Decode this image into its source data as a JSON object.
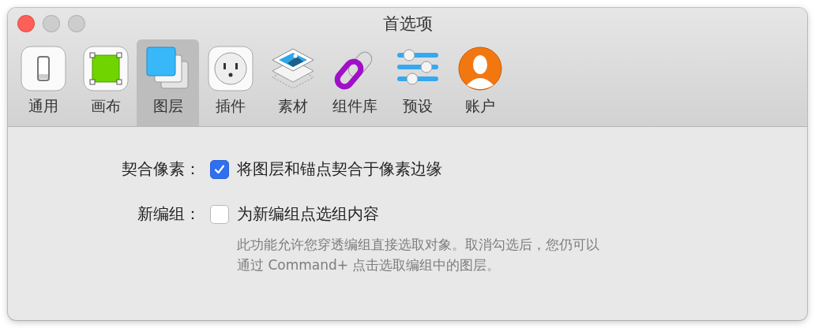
{
  "window": {
    "title": "首选项"
  },
  "tabs": [
    {
      "label": "通用",
      "kind": "switch",
      "selected": false
    },
    {
      "label": "画布",
      "kind": "canvas",
      "selected": false
    },
    {
      "label": "图层",
      "kind": "layers",
      "selected": true
    },
    {
      "label": "插件",
      "kind": "plugin",
      "selected": false
    },
    {
      "label": "素材",
      "kind": "assets",
      "selected": false
    },
    {
      "label": "组件库",
      "kind": "library",
      "selected": false
    },
    {
      "label": "预设",
      "kind": "presets",
      "selected": false
    },
    {
      "label": "账户",
      "kind": "account",
      "selected": false
    }
  ],
  "options": [
    {
      "label": "契合像素：",
      "text": "将图层和锚点契合于像素边缘",
      "checked": true
    },
    {
      "label": "新编组：",
      "text": "为新编组点选组内容",
      "checked": false,
      "description": [
        "此功能允许您穿透编组直接选取对象。取消勾选后，您仍可以",
        "通过 Command+ 点击选取编组中的图层。"
      ]
    }
  ]
}
